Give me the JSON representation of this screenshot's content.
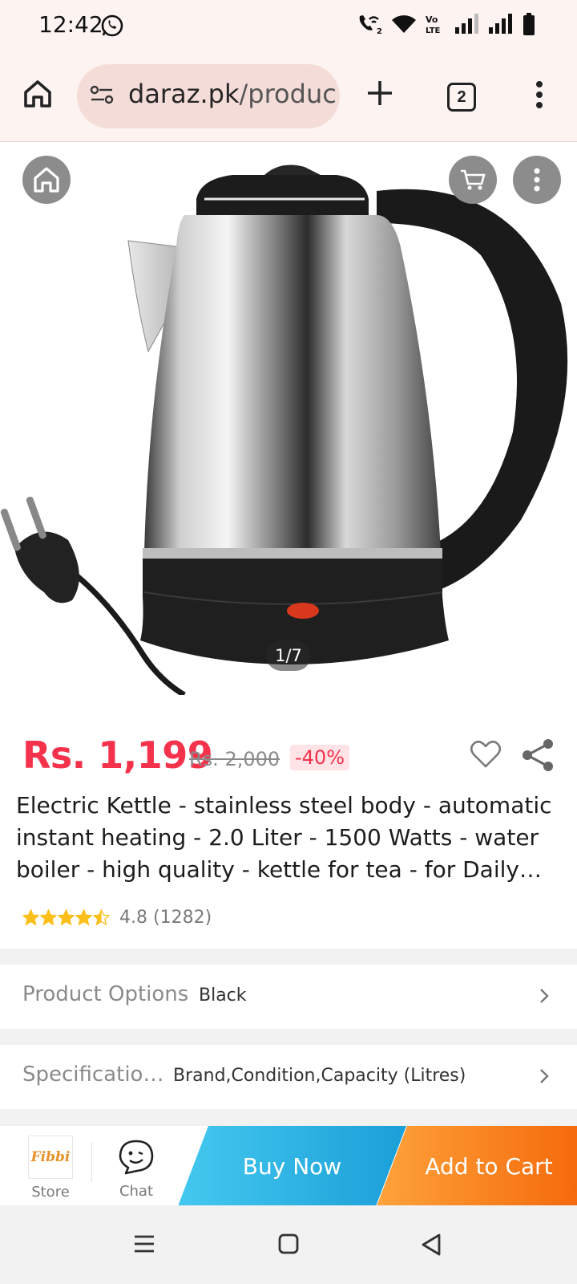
{
  "status_bar": {
    "time": "12:42",
    "icons": [
      "whatsapp-icon",
      "wifi-call-icon",
      "wifi-icon",
      "volte-icon",
      "signal-icon",
      "signal-icon",
      "battery-icon"
    ],
    "volte_label": "Vo LTE"
  },
  "browser": {
    "url_domain": "daraz.pk",
    "url_path": "/product",
    "tab_count": "2"
  },
  "gallery": {
    "counter": "1/7"
  },
  "product": {
    "price": "Rs. 1,199",
    "original_price": "Rs. 2,000",
    "discount": "-40%",
    "title": "Electric Kettle - stainless steel body - automatic instant heating - 2.0 Liter - 1500 Watts - water boiler - high quality - kettle for tea - for Daily…",
    "rating": "4.8",
    "review_count": "(1282)",
    "stars": 4.5,
    "colors": {
      "price": "#f5324c",
      "star": "#fbbf1b"
    }
  },
  "options": {
    "product_options_label": "Product Options",
    "product_options_value": "Black",
    "specification_label": "Specificatio…",
    "specification_value": "Brand,Condition,Capacity (Litres)"
  },
  "action_bar": {
    "store_logo_text": "Fibbi",
    "store_label": "Store",
    "chat_label": "Chat",
    "buy_now": "Buy Now",
    "add_to_cart": "Add to Cart",
    "colors": {
      "buy_now": "#1a9fd8",
      "add_to_cart": "#f56a0c"
    }
  }
}
